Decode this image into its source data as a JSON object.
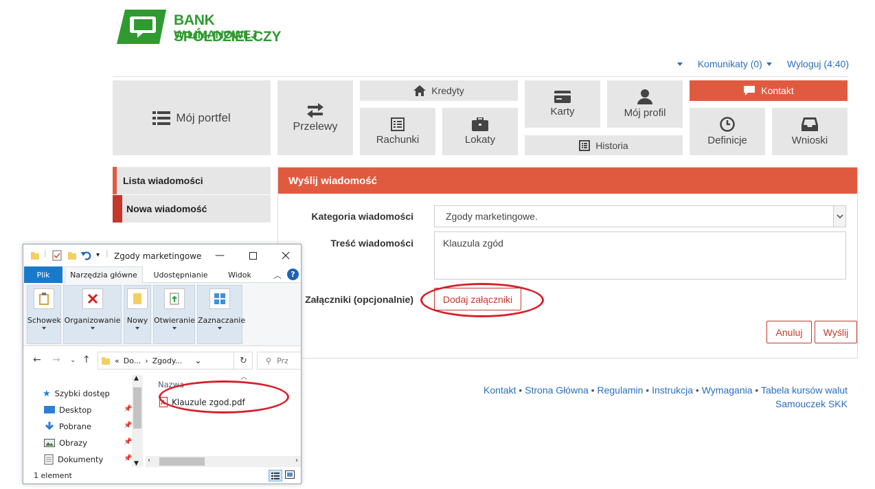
{
  "brand": {
    "line1": "BANK SPÓŁDZIELCZY",
    "line2": "W LIMANOWEJ",
    "color": "#2f9a30"
  },
  "topnav": {
    "messages": "Komunikaty (0)",
    "logout": "Wyloguj (4:40)"
  },
  "tiles": {
    "portfolio": "Mój portfel",
    "transfers": "Przelewy",
    "credits": "Kredyty",
    "accounts": "Rachunki",
    "deposits": "Lokaty",
    "cards": "Karty",
    "profile": "Mój profil",
    "history": "Historia",
    "contact": "Kontakt",
    "definitions": "Definicje",
    "applications": "Wnioski"
  },
  "sidebar": {
    "items": [
      {
        "label": "Lista wiadomości"
      },
      {
        "label": "Nowa wiadomość"
      }
    ]
  },
  "form": {
    "heading": "Wyślij wiadomość",
    "category_label": "Kategoria wiadomości",
    "category_value": "Zgody marketingowe.",
    "content_label": "Treść wiadomości",
    "content_value": "Klauzula zgód",
    "attachments_label": "Załączniki (opcjonalnie)",
    "add_attachments": "Dodaj załączniki",
    "cancel": "Anuluj",
    "send": "Wyślij"
  },
  "footer": {
    "links": [
      "Kontakt",
      "Strona Główna",
      "Regulamin",
      "Instrukcja",
      "Wymagania",
      "Tabela kursów walut"
    ],
    "second_line": "Samouczek SKK"
  },
  "explorer": {
    "title": "Zgody marketingowe",
    "tabs": [
      "Plik",
      "Narzędzia główne",
      "Udostępnianie",
      "Widok"
    ],
    "groups": [
      "Schowek",
      "Organizowanie",
      "Nowy",
      "Otwieranie",
      "Zaznaczanie"
    ],
    "address": {
      "part1": "Do...",
      "part2": "Zgody..."
    },
    "search_placeholder": "Prz",
    "nav": [
      {
        "label": "Szybki dostęp",
        "icon": "star-icon"
      },
      {
        "label": "Desktop",
        "icon": "desktop-icon"
      },
      {
        "label": "Pobrane",
        "icon": "download-icon"
      },
      {
        "label": "Obrazy",
        "icon": "pictures-icon"
      },
      {
        "label": "Dokumenty",
        "icon": "documents-icon"
      }
    ],
    "column_name": "Nazwa",
    "file": "Klauzule zgod.pdf",
    "status": "1 element"
  },
  "colors": {
    "accent": "#e05a40",
    "link": "#2a6ebb",
    "highlight": "#d6202a"
  }
}
